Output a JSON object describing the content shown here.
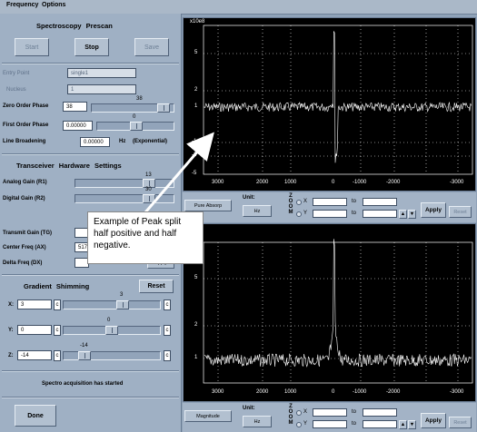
{
  "menu": {
    "frequency": "Frequency",
    "options": "Options"
  },
  "left": {
    "title": "Spectroscopy    Prescan",
    "start": "Start",
    "stop": "Stop",
    "save": "Save",
    "entry_point_label": "Entry Point",
    "entry_point_value": "single1",
    "nucleus_label": "Nucleus",
    "nucleus_value": "1",
    "zero_order_label": "Zero Order Phase",
    "zero_order_value": "38",
    "zero_order_slider": "38",
    "first_order_label": "First Order Phase",
    "first_order_value": "0.00000",
    "first_order_slider": "0",
    "line_broadening_label": "Line Broadening",
    "line_broadening_value": "0.00000",
    "line_broadening_unit": "Hz",
    "line_broadening_mode": "(Exponential)",
    "transceiver_title": "Transceiver    Hardware    Settings",
    "analog_gain_label": "Analog Gain (R1)",
    "analog_gain_value": "13",
    "digital_gain_label": "Digital Gain (R2)",
    "digital_gain_value": "30",
    "transmit_gain_label": "Transmit Gain (TG)",
    "center_freq_label": "Center Freq (AX)",
    "center_freq_value": "517",
    "delta_freq_label": "Delta Freq (DX)",
    "delta_apply": "Apply",
    "gradient_title": "Gradient    Shimming",
    "reset": "Reset",
    "x_label": "X:",
    "x_value": "3",
    "x_slider": "3",
    "y_label": "Y:",
    "y_value": "0",
    "y_slider": "0",
    "z_label": "Z:",
    "z_value": "-14",
    "z_slider": "-14",
    "c": "c",
    "status": "Spectro acquisition has started",
    "done": "Done"
  },
  "top_plot": {
    "scale_label": "x10e8",
    "y_ticks": [
      "5",
      "2",
      "1",
      "-1",
      "-2",
      "-5"
    ],
    "x_ticks": [
      "3000",
      "2000",
      "1000",
      "0",
      "-1000",
      "-2000",
      "-3000"
    ]
  },
  "bottom_plot": {
    "y_ticks": [
      "5",
      "2",
      "1"
    ],
    "x_ticks": [
      "3000",
      "2000",
      "1000",
      "0",
      "-1000",
      "-2000",
      "-3000"
    ]
  },
  "controls_top": {
    "mode": "Pure Absorp",
    "unit_label": "Unit:",
    "unit_value": "Hz",
    "zoom_letters": [
      "Z",
      "O",
      "O",
      "M"
    ],
    "x": "X",
    "y": "Y",
    "to": "to",
    "apply": "Apply",
    "reset": "Reset"
  },
  "controls_bottom": {
    "mode": "Magnitude",
    "unit_label": "Unit:",
    "unit_value": "Hz",
    "zoom_letters": [
      "Z",
      "O",
      "O",
      "M"
    ],
    "x": "X",
    "y": "Y",
    "to": "to",
    "apply": "Apply",
    "reset": "Reset"
  },
  "annotation": "Example of Peak split half positive and half negative."
}
